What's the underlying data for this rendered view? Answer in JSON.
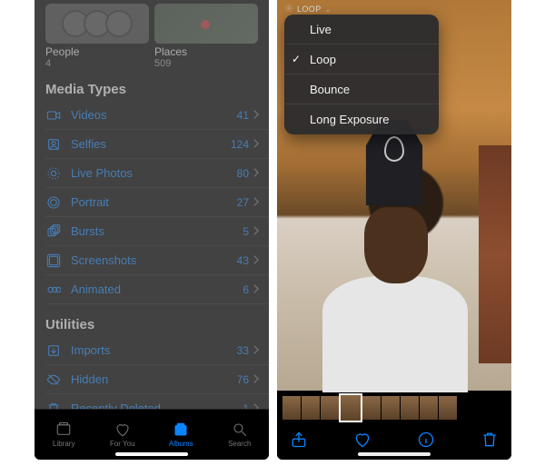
{
  "left": {
    "people_places": {
      "people": {
        "label": "People",
        "count": "4"
      },
      "places": {
        "label": "Places",
        "count": "509"
      }
    },
    "sections": {
      "media_types": {
        "header": "Media Types",
        "rows": [
          {
            "icon": "video-icon",
            "label": "Videos",
            "count": "41"
          },
          {
            "icon": "selfie-icon",
            "label": "Selfies",
            "count": "124"
          },
          {
            "icon": "livephoto-icon",
            "label": "Live Photos",
            "count": "80"
          },
          {
            "icon": "portrait-icon",
            "label": "Portrait",
            "count": "27"
          },
          {
            "icon": "burst-icon",
            "label": "Bursts",
            "count": "5"
          },
          {
            "icon": "screenshot-icon",
            "label": "Screenshots",
            "count": "43"
          },
          {
            "icon": "animated-icon",
            "label": "Animated",
            "count": "6"
          }
        ]
      },
      "utilities": {
        "header": "Utilities",
        "rows": [
          {
            "icon": "imports-icon",
            "label": "Imports",
            "count": "33"
          },
          {
            "icon": "hidden-icon",
            "label": "Hidden",
            "count": "76"
          },
          {
            "icon": "trash-icon",
            "label": "Recently Deleted",
            "count": "1"
          }
        ]
      }
    },
    "tabs": {
      "library": "Library",
      "foryou": "For You",
      "albums": "Albums",
      "search": "Search",
      "active": "albums"
    }
  },
  "right": {
    "badge": "LOOP",
    "menu": [
      {
        "label": "Live",
        "selected": false
      },
      {
        "label": "Loop",
        "selected": true
      },
      {
        "label": "Bounce",
        "selected": false
      },
      {
        "label": "Long Exposure",
        "selected": false
      }
    ]
  }
}
